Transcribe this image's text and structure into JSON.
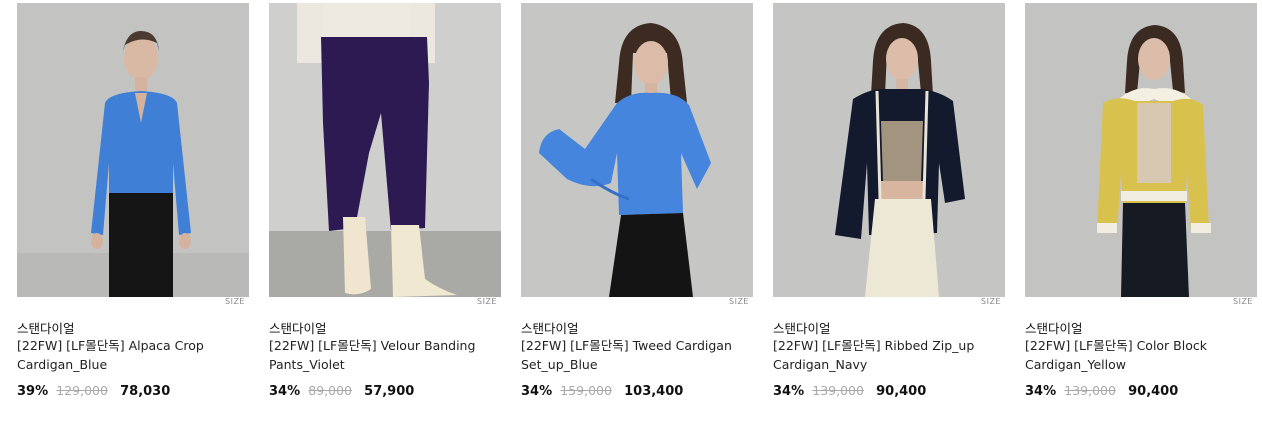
{
  "products": [
    {
      "brand": "스탠다이얼",
      "name": "[22FW] [LF몰단독] Alpaca Crop Cardigan_Blue",
      "size_label": "SIZE",
      "discount": "39%",
      "original_price": "129,000",
      "sale_price": "78,030",
      "image": "model-blue-alpaca-cardigan"
    },
    {
      "brand": "스탠다이얼",
      "name": "[22FW] [LF몰단독] Velour Banding Pants_Violet",
      "size_label": "SIZE",
      "discount": "34%",
      "original_price": "89,000",
      "sale_price": "57,900",
      "image": "model-violet-velour-pants"
    },
    {
      "brand": "스탠다이얼",
      "name": "[22FW] [LF몰단독] Tweed Cardigan Set_up_Blue",
      "size_label": "SIZE",
      "discount": "34%",
      "original_price": "159,000",
      "sale_price": "103,400",
      "image": "model-blue-tweed-cardigan"
    },
    {
      "brand": "스탠다이얼",
      "name": "[22FW] [LF몰단독] Ribbed Zip_up Cardigan_Navy",
      "size_label": "SIZE",
      "discount": "34%",
      "original_price": "139,000",
      "sale_price": "90,400",
      "image": "model-navy-zipup-cardigan"
    },
    {
      "brand": "스탠다이얼",
      "name": "[22FW] [LF몰단독] Color Block Cardigan_Yellow",
      "size_label": "SIZE",
      "discount": "34%",
      "original_price": "139,000",
      "sale_price": "90,400",
      "image": "model-yellow-colorblock-cardigan"
    }
  ]
}
